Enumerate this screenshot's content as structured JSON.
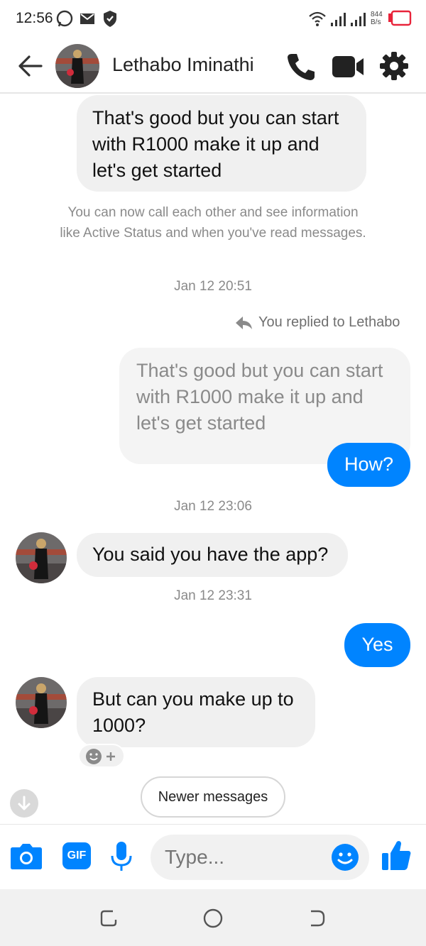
{
  "status_bar": {
    "time": "12:56",
    "speed_value": "844",
    "speed_unit": "B/s"
  },
  "header": {
    "contact_name": "Lethabo Iminathi"
  },
  "messages": {
    "m1": "That's good but you can start with R1000 make it up and let's get started",
    "notice": "You can now call each other and see information like Active Status and when you've read messages.",
    "ts1": "Jan 12 20:51",
    "replied_label": "You replied to Lethabo",
    "quoted": "That's good but you can start with R1000 make it up and let's get started",
    "m2": "How?",
    "ts2": "Jan 12 23:06",
    "m3": "You said you have the app?",
    "ts3": "Jan 12 23:31",
    "m4": "Yes",
    "m5": "But can you make up to 1000?"
  },
  "newer_messages_label": "Newer messages",
  "composer": {
    "placeholder": "Type...",
    "gif_label": "GIF"
  },
  "colors": {
    "accent": "#0084ff",
    "bubble_gray": "#f0f0f0",
    "meta_text": "#8a8a8a"
  }
}
